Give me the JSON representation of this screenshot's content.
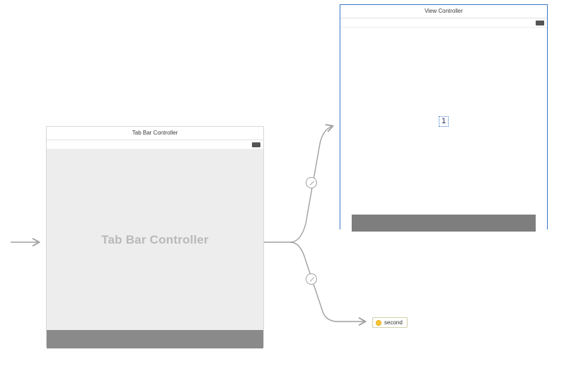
{
  "scenes": {
    "tabbar": {
      "title": "Tab Bar Controller",
      "watermark": "Tab Bar Controller"
    },
    "view": {
      "title": "View Controller",
      "center_label": "1"
    },
    "reference": {
      "label": "second"
    }
  }
}
